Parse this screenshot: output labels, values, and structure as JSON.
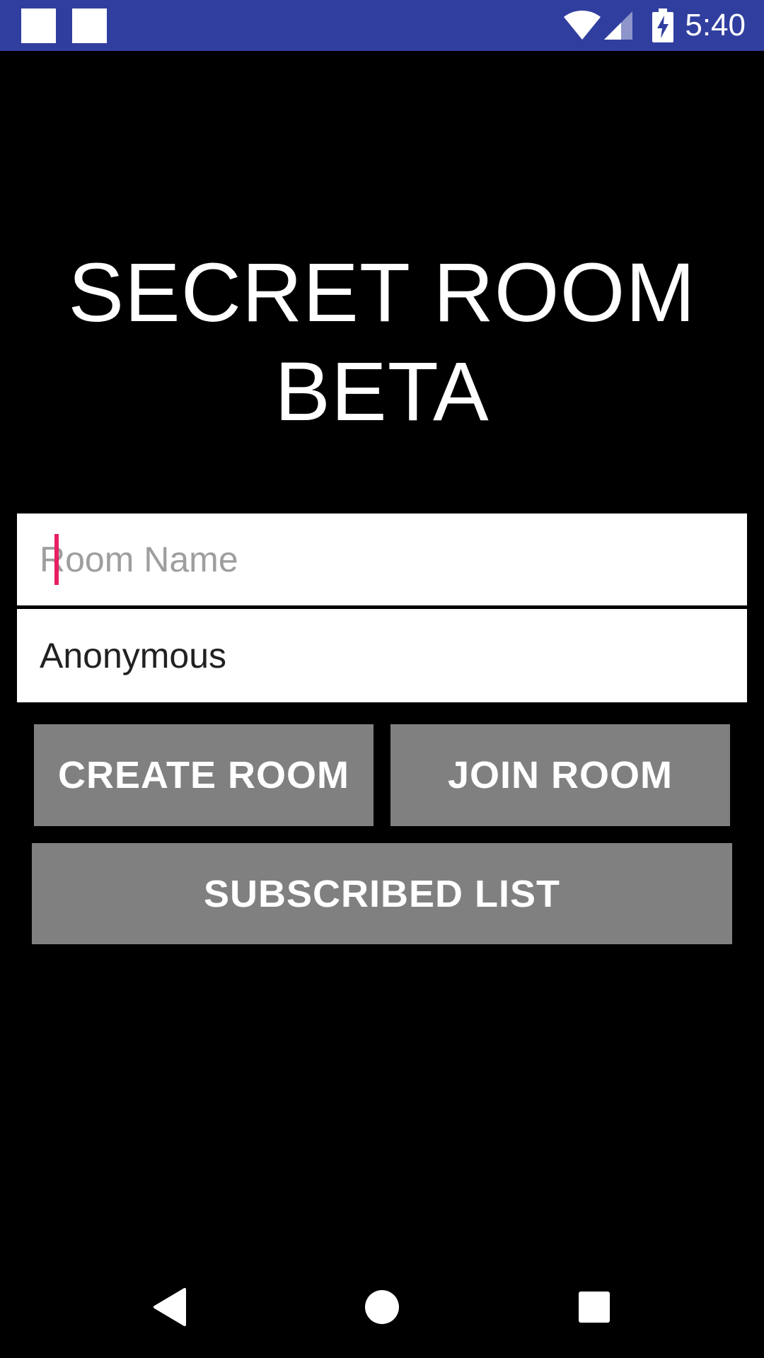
{
  "status_bar": {
    "time": "5:40",
    "background_color": "#303F9F",
    "icons": [
      "notification-square-icon",
      "notification-square-icon",
      "wifi-icon",
      "signal-icon",
      "battery-charging-icon"
    ]
  },
  "app": {
    "title_line1": "SECRET ROOM",
    "title_line2": "BETA"
  },
  "form": {
    "room_name": {
      "placeholder": "Room Name",
      "value": ""
    },
    "user_name": {
      "placeholder": "",
      "value": "Anonymous"
    }
  },
  "buttons": {
    "create_room": "CREATE ROOM",
    "join_room": "JOIN ROOM",
    "subscribed_list": "SUBSCRIBED LIST",
    "button_color": "#808080"
  },
  "nav_bar": {
    "icons": [
      "back-icon",
      "home-icon",
      "recent-apps-icon"
    ]
  },
  "colors": {
    "accent": "#E91E63",
    "background": "#000000"
  }
}
